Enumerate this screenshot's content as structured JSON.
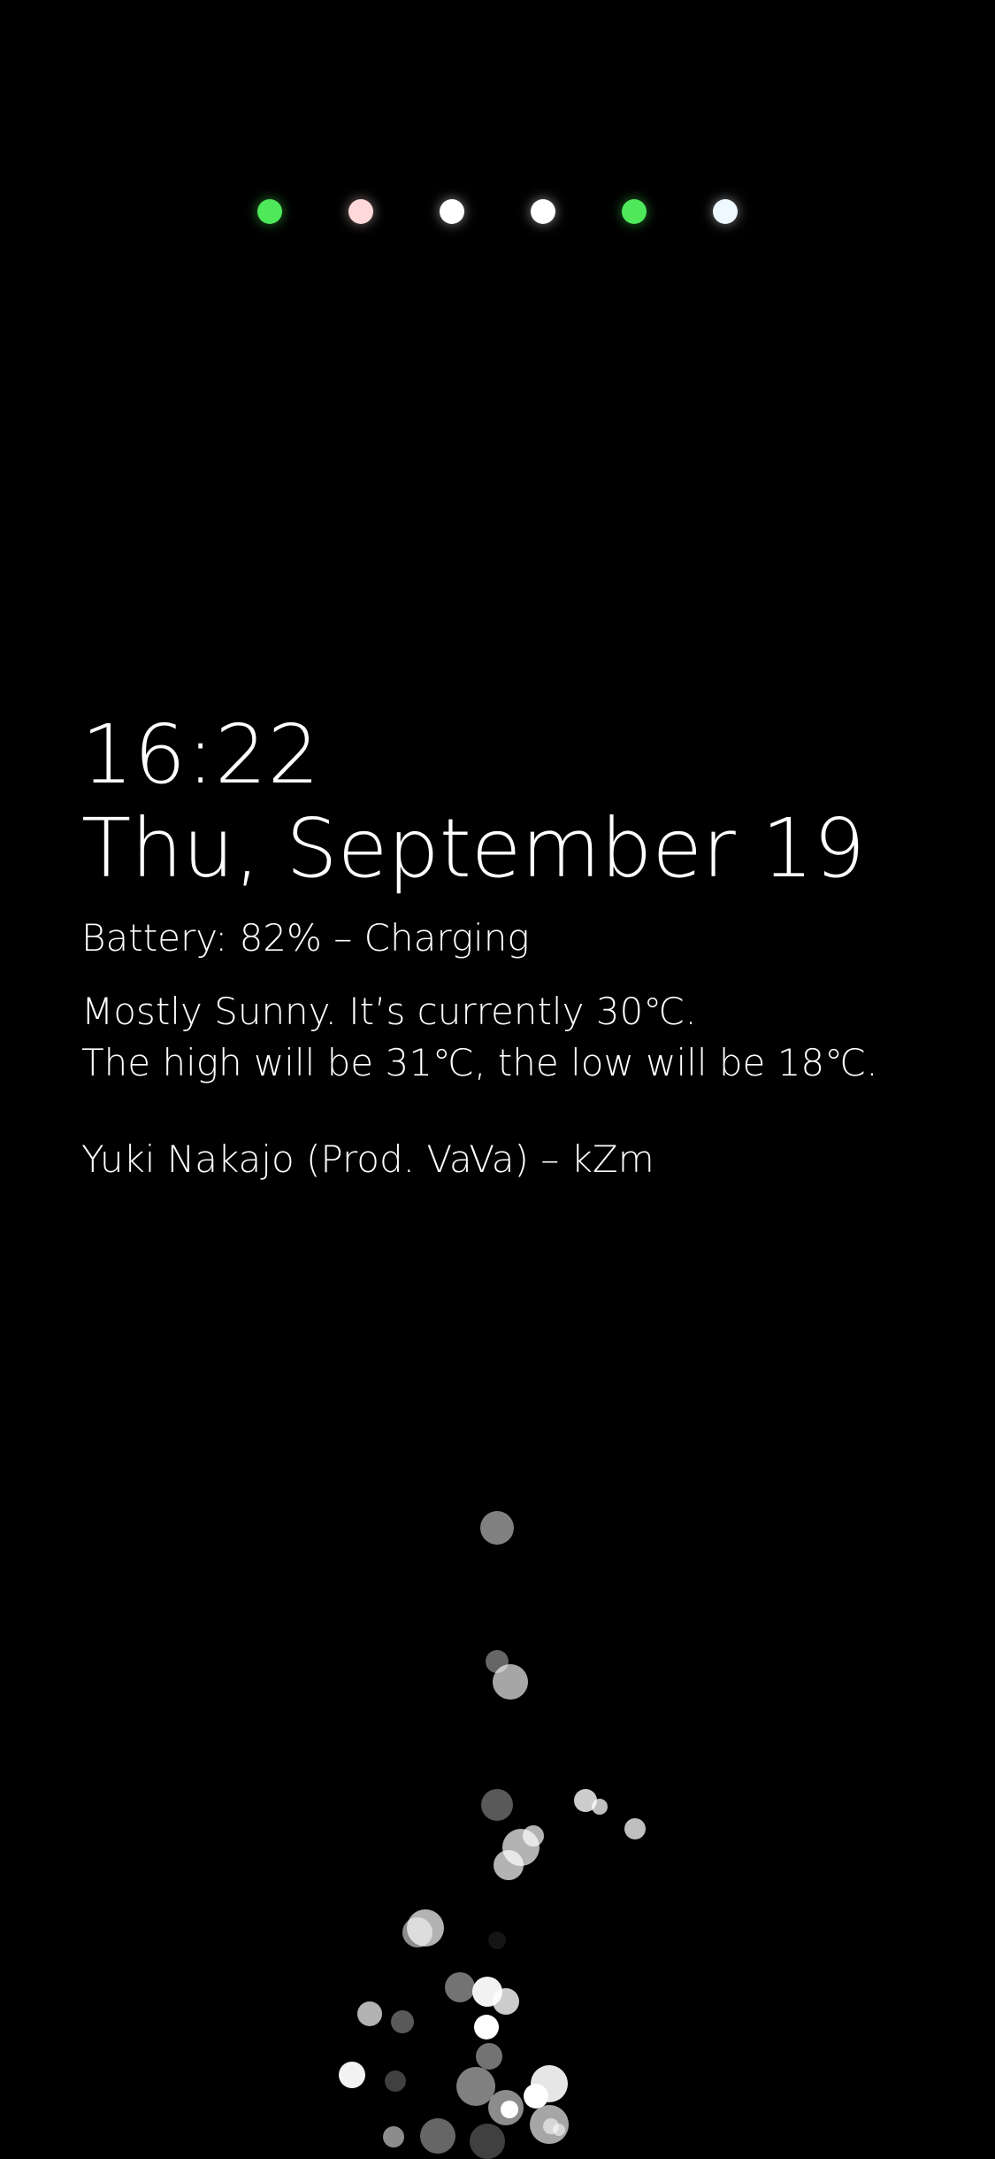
{
  "notifications": [
    {
      "icon": "notification-dot-icon",
      "color": "#4ee85a"
    },
    {
      "icon": "notification-dot-icon",
      "color": "#ffd9d9"
    },
    {
      "icon": "notification-dot-icon",
      "color": "#ffffff"
    },
    {
      "icon": "notification-dot-icon",
      "color": "#ffffff"
    },
    {
      "icon": "notification-dot-icon",
      "color": "#4ee85a"
    },
    {
      "icon": "notification-dot-icon",
      "color": "#eef8ff"
    }
  ],
  "clock": {
    "time": "16:22",
    "date": "Thu, September 19"
  },
  "battery": {
    "text": "Battery: 82% – Charging",
    "level_percent": 82
  },
  "weather": {
    "line1": "Mostly Sunny. It’s currently 30℃.",
    "line2": "The high will be 31℃, the low will be 18℃."
  },
  "now_playing": {
    "text": "Yuki Nakajo (Prod. VaVa) – kZm"
  },
  "colors": {
    "background": "#000000",
    "text": "#ffffff",
    "accent_green": "#4ee85a"
  }
}
